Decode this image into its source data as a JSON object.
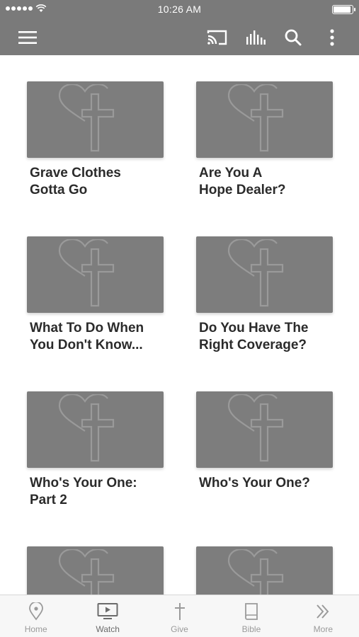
{
  "status_bar": {
    "time": "10:26 AM",
    "signal_dots": 5
  },
  "app_bar": {
    "icons": [
      "hamburger-menu-icon",
      "cast-icon",
      "audio-bars-icon",
      "search-icon",
      "more-vertical-icon"
    ]
  },
  "content": {
    "items": [
      {
        "title": "Grave Clothes\nGotta Go"
      },
      {
        "title": "Are You A\nHope Dealer?"
      },
      {
        "title": "What To Do When\nYou Don't Know..."
      },
      {
        "title": "Do You Have The\nRight Coverage?"
      },
      {
        "title": "Who's Your One:\nPart 2"
      },
      {
        "title": "Who's Your One?"
      },
      {
        "title": ""
      },
      {
        "title": ""
      }
    ]
  },
  "tab_bar": {
    "tabs": [
      {
        "label": "Home",
        "icon": "location-pin-icon"
      },
      {
        "label": "Watch",
        "icon": "tv-play-icon"
      },
      {
        "label": "Give",
        "icon": "cross-icon"
      },
      {
        "label": "Bible",
        "icon": "book-icon"
      },
      {
        "label": "More",
        "icon": "double-chevron-right-icon"
      }
    ],
    "active": "Watch"
  },
  "colors": {
    "header": "#7a7a7a",
    "thumbnail": "#7d7d7d",
    "title_text": "#2b2b2b",
    "tab_inactive": "#9a9a9a",
    "tab_active": "#6b6b6b"
  }
}
